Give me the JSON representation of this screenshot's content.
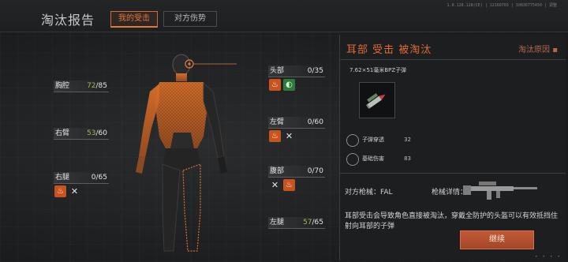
{
  "header": {
    "title": "淘汰报告",
    "tabs": [
      {
        "label": "我的受击",
        "active": true
      },
      {
        "label": "对方伤势",
        "active": false
      }
    ],
    "build_info": "1.0.128.128(CE) | 12160703 | 10836775450 | 调整"
  },
  "body_parts": [
    {
      "id": "head",
      "name": "头部",
      "current": "0",
      "max": "/35",
      "icons": [
        "bleed-icon",
        "hearing-icon"
      ]
    },
    {
      "id": "chest",
      "name": "胸腔",
      "current": "72",
      "max": "/85",
      "icons": []
    },
    {
      "id": "left_arm",
      "name": "左臂",
      "current": "0",
      "max": "/60",
      "icons": [
        "bleed-icon",
        "fracture-icon"
      ]
    },
    {
      "id": "right_arm",
      "name": "右臂",
      "current": "53",
      "max": "/60",
      "icons": []
    },
    {
      "id": "stomach",
      "name": "腹部",
      "current": "0",
      "max": "/70",
      "icons": [
        "fracture-icon",
        "bleed-icon"
      ]
    },
    {
      "id": "right_leg",
      "name": "右腿",
      "current": "0",
      "max": "/65",
      "icons": [
        "bleed-icon",
        "fracture-icon"
      ]
    },
    {
      "id": "left_leg",
      "name": "左腿",
      "current": "57",
      "max": "/65",
      "icons": []
    }
  ],
  "report": {
    "title": "耳部 受击 被淘汰",
    "reason_link": "淘汰原因",
    "ammo_name": "7.62×51毫米BPZ子弹",
    "stats": [
      {
        "label": "子弹穿透",
        "value": "32",
        "icon": "penetration-icon"
      },
      {
        "label": "基础伤害",
        "value": "83",
        "icon": "crosshair-icon"
      }
    ],
    "enemy_weapon_label": "对方枪械：FAL",
    "weapon_detail_label": "枪械详情：",
    "description": "耳部受击会导致角色直接被淘汰，穿戴全防护的头盔可以有效抵挡住射向耳部的子弹",
    "continue_label": "继续"
  },
  "colors": {
    "accent": "#e0793f",
    "title_red": "#e26a35",
    "health_green": "#9fbb55",
    "bleed": "#c8531f"
  }
}
